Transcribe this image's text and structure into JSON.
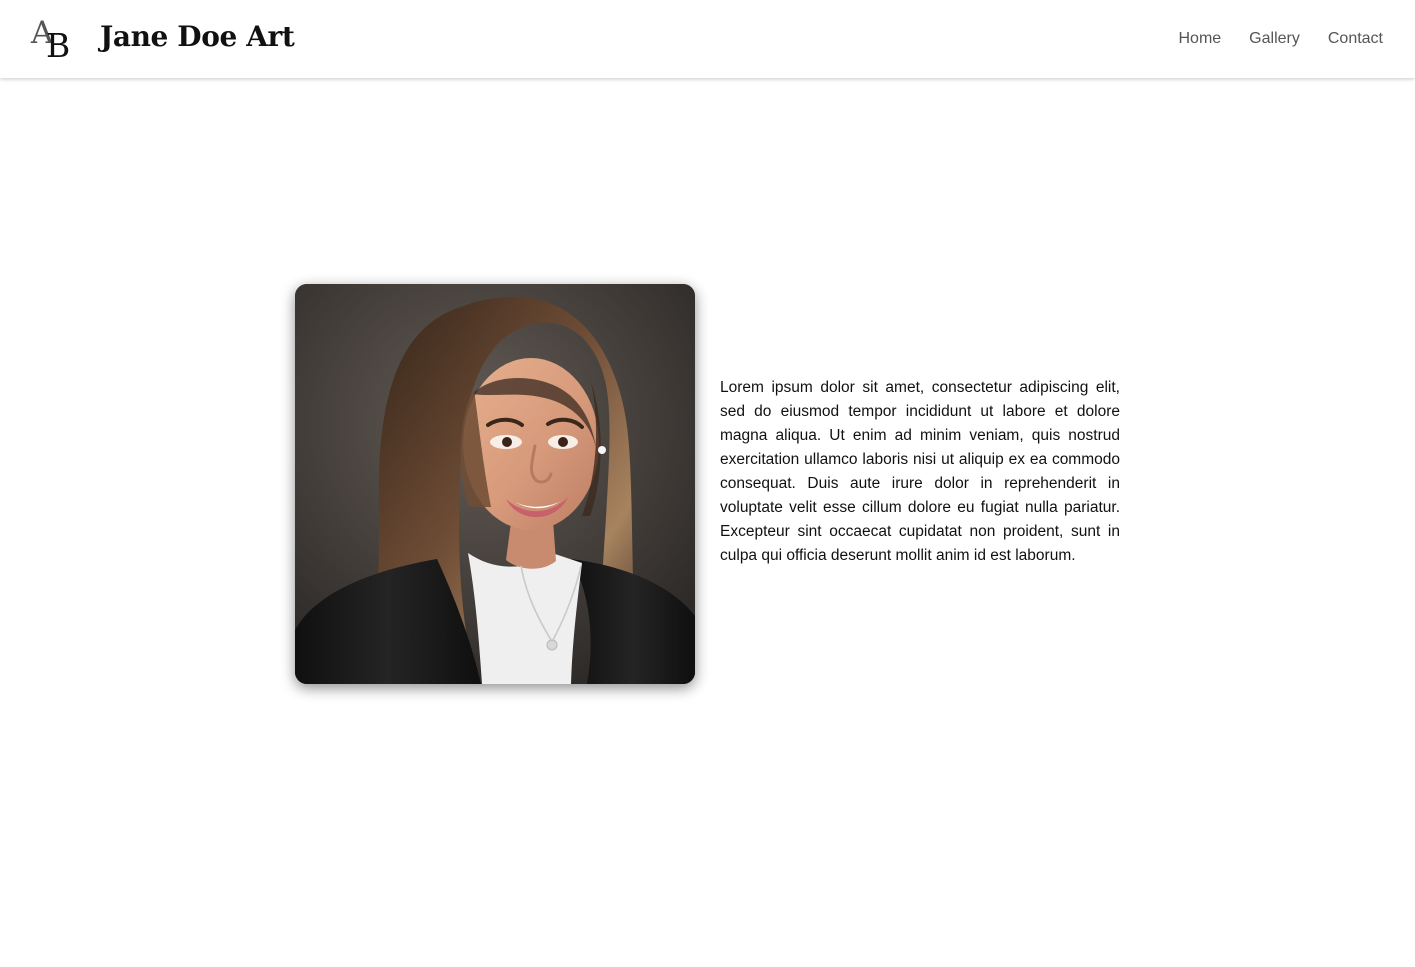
{
  "header": {
    "logo": {
      "letter_a": "A",
      "letter_b": "B"
    },
    "brand_title": "Jane Doe Art",
    "nav": [
      {
        "label": "Home"
      },
      {
        "label": "Gallery"
      },
      {
        "label": "Contact"
      }
    ]
  },
  "main": {
    "portrait": {
      "alt": "Portrait of a smiling woman"
    },
    "body_text": "Lorem ipsum dolor sit amet, consectetur adipiscing elit, sed do eiusmod tempor incididunt ut labore et dolore magna aliqua. Ut enim ad minim veniam, quis nostrud exercitation ullamco laboris nisi ut aliquip ex ea commodo consequat. Duis aute irure dolor in reprehenderit in voluptate velit esse cillum dolore eu fugiat nulla pariatur. Excepteur sint occaecat cupidatat non proident, sunt in culpa qui officia deserunt mollit anim id est laborum."
  },
  "colors": {
    "page_background": "#ffffff",
    "text": "#111111",
    "nav_text": "#555555"
  }
}
